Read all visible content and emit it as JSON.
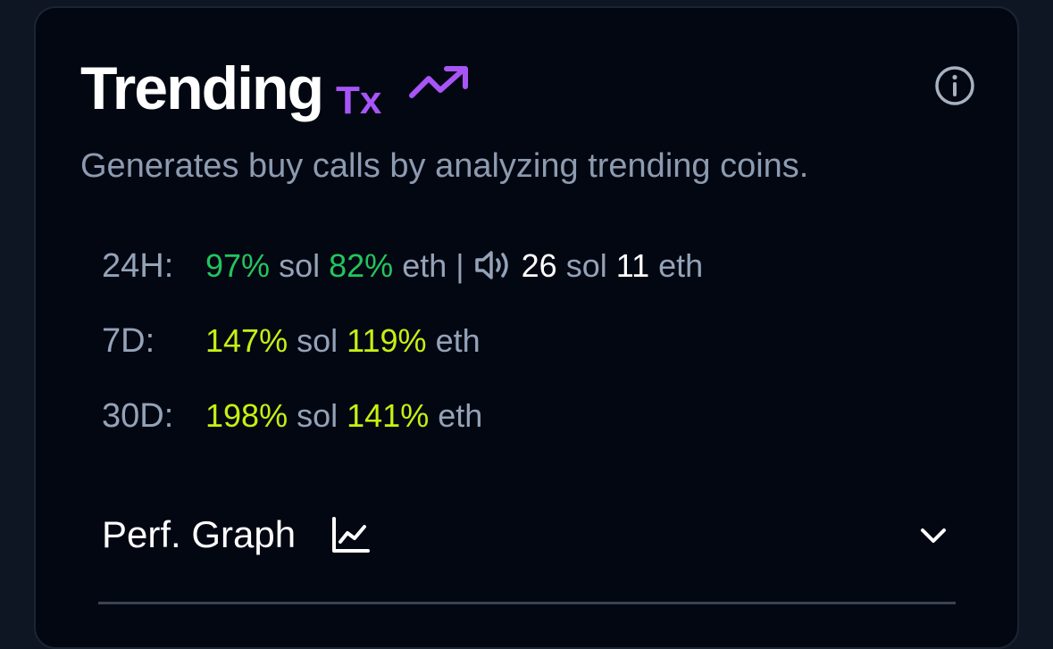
{
  "card": {
    "title": "Trending",
    "title_badge": "Tx",
    "subtitle": "Generates buy calls by analyzing trending coins.",
    "icons": {
      "trend": "trending-up-icon",
      "info": "info-icon"
    },
    "colors": {
      "background": "#030712",
      "accent_purple": "#a855f7",
      "positive_green": "#22c55e",
      "positive_yellow": "#c7f011",
      "muted": "#94a3b8"
    }
  },
  "stats": {
    "h24": {
      "label": "24H:",
      "sol_pct": "97%",
      "sol_label": "sol",
      "eth_pct": "82%",
      "eth_label": "eth |",
      "volume_icon": "speaker-icon",
      "sol_count": "26",
      "sol_count_label": "sol",
      "eth_count": "11",
      "eth_count_label": "eth"
    },
    "d7": {
      "label": "7D:",
      "sol_pct": "147%",
      "sol_label": "sol",
      "eth_pct": "119%",
      "eth_label": "eth"
    },
    "d30": {
      "label": "30D:",
      "sol_pct": "198%",
      "sol_label": "sol",
      "eth_pct": "141%",
      "eth_label": "eth"
    }
  },
  "perf_graph": {
    "label": "Perf. Graph",
    "icon": "line-chart-icon",
    "toggle_icon": "chevron-down-icon"
  }
}
